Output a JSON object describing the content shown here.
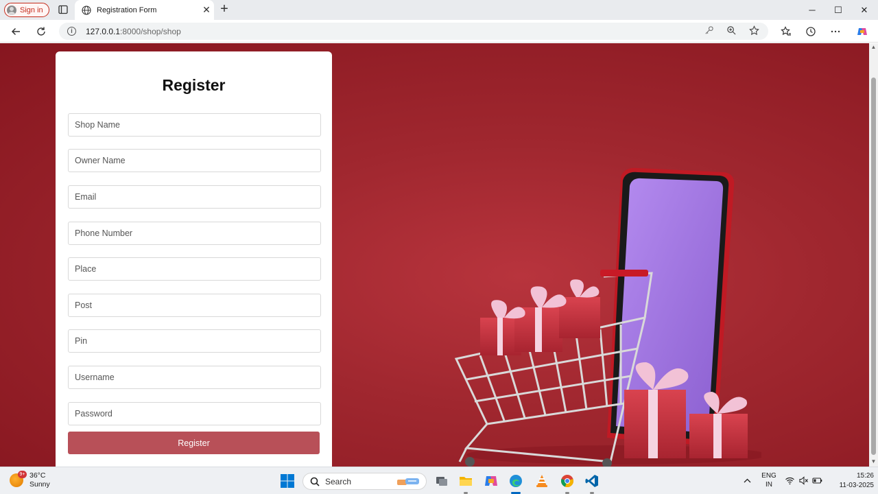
{
  "browser": {
    "signin_label": "Sign in",
    "tab_title": "Registration Form",
    "url_host": "127.0.0.1",
    "url_path": ":8000/shop/shop"
  },
  "form": {
    "title": "Register",
    "fields": [
      {
        "placeholder": "Shop Name"
      },
      {
        "placeholder": "Owner Name"
      },
      {
        "placeholder": "Email"
      },
      {
        "placeholder": "Phone Number"
      },
      {
        "placeholder": "Place"
      },
      {
        "placeholder": "Post"
      },
      {
        "placeholder": "Pin"
      },
      {
        "placeholder": "Username"
      },
      {
        "placeholder": "Password"
      }
    ],
    "submit_label": "Register"
  },
  "taskbar": {
    "weather_temp": "36°C",
    "weather_cond": "Sunny",
    "weather_badge": "9+",
    "search_label": "Search",
    "lang_1": "ENG",
    "lang_2": "IN",
    "time": "15:26",
    "date": "11-03-2025"
  },
  "colors": {
    "accent": "#b85058",
    "page_bg": "#a0272f",
    "signin_red": "#c42b1c"
  }
}
